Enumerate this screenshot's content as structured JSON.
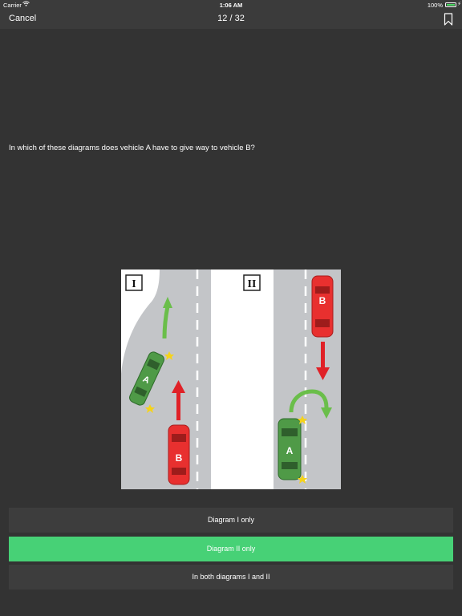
{
  "status_bar": {
    "carrier": "Carrier",
    "time": "1:06 AM",
    "battery": "100%"
  },
  "nav": {
    "cancel_label": "Cancel",
    "progress": "12 / 32",
    "bookmark_icon": "bookmark-icon"
  },
  "question": {
    "text": "In which of these diagrams does vehicle A have to give way to vehicle B?"
  },
  "diagram": {
    "panel_1_label": "I",
    "panel_2_label": "II",
    "vehicle_a_label": "A",
    "vehicle_b_label": "B",
    "vehicle_a_color": "#4f9a47",
    "vehicle_b_color": "#e8302f",
    "arrow_green": "#6abe4a",
    "arrow_red": "#e02127",
    "road_color": "#c3c5c8"
  },
  "answers": [
    {
      "label": "Diagram I only",
      "selected": false
    },
    {
      "label": "Diagram II only",
      "selected": true
    },
    {
      "label": "In both diagrams I and II",
      "selected": false
    }
  ],
  "colors": {
    "background": "#333333",
    "bar": "#3b3b3b",
    "answer_bg": "#3d3d3d",
    "selected_answer": "#47d176"
  }
}
